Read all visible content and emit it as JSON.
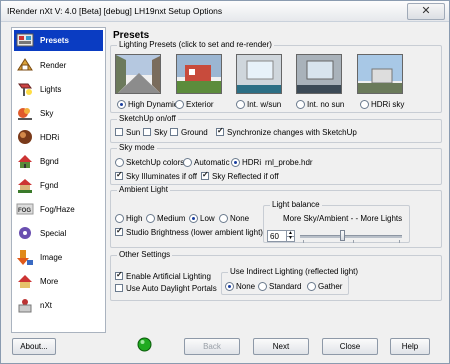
{
  "window": {
    "title": "IRender nXt V: 4.0 [Beta] [debug] LH19nxt Setup Options",
    "close_label": "✕"
  },
  "sidebar": {
    "items": [
      {
        "label": "Presets",
        "icon": "presets-icon"
      },
      {
        "label": "Render",
        "icon": "render-icon"
      },
      {
        "label": "Lights",
        "icon": "lights-icon"
      },
      {
        "label": "Sky",
        "icon": "sky-icon"
      },
      {
        "label": "HDRi",
        "icon": "hdri-icon"
      },
      {
        "label": "Bgnd",
        "icon": "background-icon"
      },
      {
        "label": "Fgnd",
        "icon": "foreground-icon"
      },
      {
        "label": "Fog/Haze",
        "icon": "fog-icon"
      },
      {
        "label": "Special",
        "icon": "special-icon"
      },
      {
        "label": "Image",
        "icon": "image-icon"
      },
      {
        "label": "More",
        "icon": "more-icon"
      },
      {
        "label": "nXt",
        "icon": "nxt-icon"
      }
    ],
    "icon_text": {
      "fog": "FOG"
    },
    "selected": "Presets"
  },
  "main": {
    "title": "Presets"
  },
  "lighting_presets": {
    "legend": "Lighting Presets (click to set and re-render)",
    "options": [
      {
        "label": "High Dynamic",
        "checked": true
      },
      {
        "label": "Exterior",
        "checked": false
      },
      {
        "label": "Int. w/sun",
        "checked": false
      },
      {
        "label": "Int. no sun",
        "checked": false
      },
      {
        "label": "HDRi sky",
        "checked": false
      }
    ]
  },
  "sketchup_onoff": {
    "legend": "SketchUp on/off",
    "sun": "Sun",
    "sky": "Sky",
    "ground": "Ground",
    "sync": "Synchronize changes with SketchUp"
  },
  "sky_mode": {
    "legend": "Sky mode",
    "sketchup_colors": "SketchUp colors",
    "automatic": "Automatic",
    "hdri": "HDRi",
    "hdri_file": "rnl_probe.hdr",
    "illuminates": "Sky Illuminates if off",
    "reflected": "Sky Reflected if off"
  },
  "ambient_light": {
    "legend": "Ambient Light",
    "high": "High",
    "medium": "Medium",
    "low": "Low",
    "none": "None",
    "studio": "Studio Brightness (lower ambient light)"
  },
  "light_balance": {
    "legend": "Light balance",
    "caption": "More Sky/Ambient -  - More Lights",
    "value": "60",
    "slider_fraction": 0.41
  },
  "other_settings": {
    "legend": "Other Settings",
    "artificial": "Enable Artificial Lighting",
    "daylight": "Use Auto Daylight Portals"
  },
  "indirect": {
    "legend": "Use Indirect Lighting (reflected light)",
    "none": "None",
    "standard": "Standard",
    "gather": "Gather"
  },
  "footer": {
    "about": "About...",
    "back": "Back",
    "next": "Next",
    "close": "Close",
    "help": "Help"
  },
  "colors": {
    "selected": "#0a3cc2",
    "status": "#1faa1f"
  }
}
